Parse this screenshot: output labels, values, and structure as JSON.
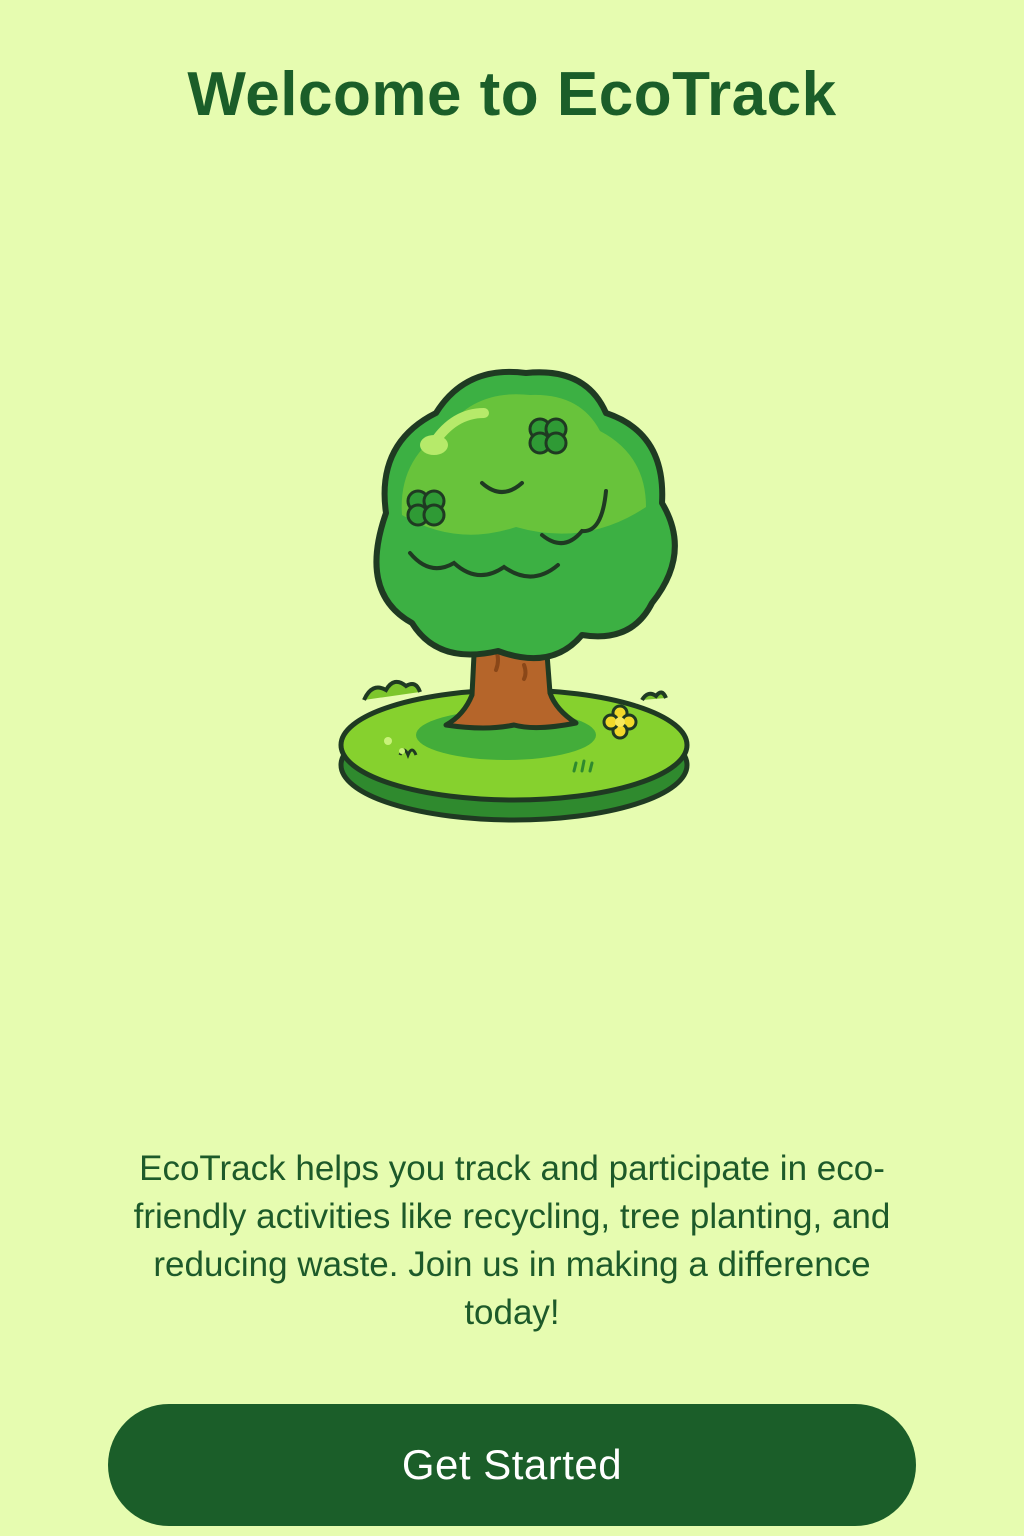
{
  "header": {
    "title": "Welcome to EcoTrack"
  },
  "hero": {
    "icon": "smiling-tree-illustration"
  },
  "main": {
    "description": "EcoTrack helps you track and participate in eco-friendly activities like recycling, tree planting, and reducing waste. Join us in making a difference today!"
  },
  "actions": {
    "get_started_label": "Get Started"
  },
  "colors": {
    "background": "#e6fcb0",
    "primary": "#1b5e29",
    "canopy": "#3cb043",
    "trunk": "#b5652a",
    "grass": "#7ccc2c"
  }
}
